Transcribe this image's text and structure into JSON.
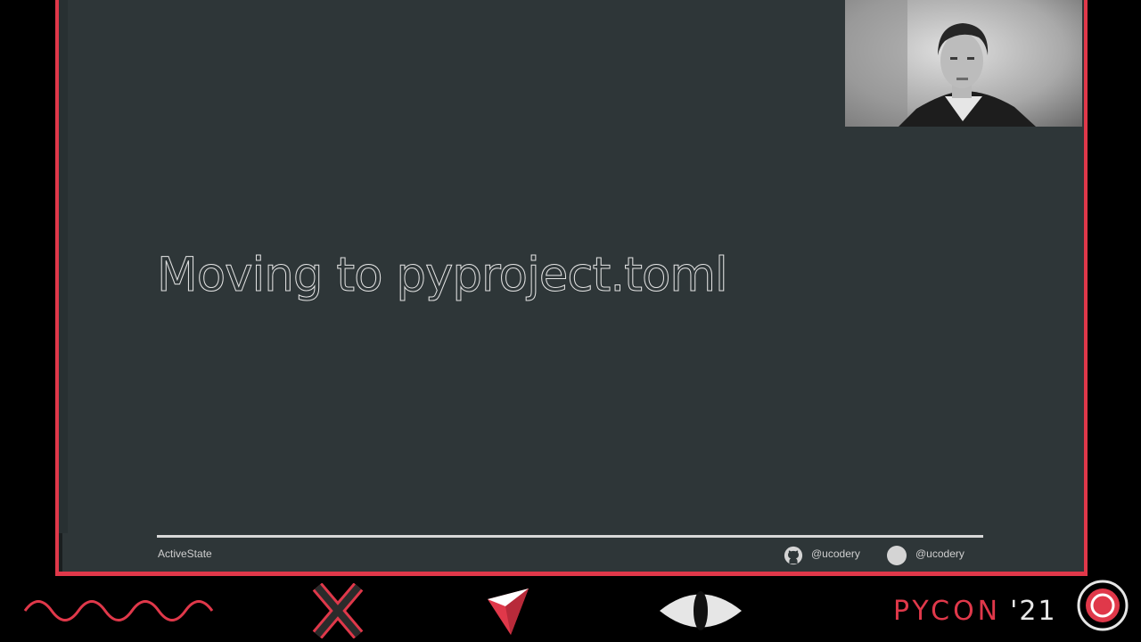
{
  "slide": {
    "title": "Moving to pyproject.toml",
    "footer": {
      "brand": "ActiveState",
      "github_handle": "@ucodery",
      "twitter_handle": "@ucodery"
    }
  },
  "conference": {
    "name": "PYCON",
    "year": "'21"
  },
  "colors": {
    "accent": "#e0384a",
    "slide_background": "#2e3638",
    "text": "#e4e4e4"
  },
  "icons": [
    "github-icon",
    "twitter-icon",
    "wave-icon",
    "x-icon",
    "triangle-icon",
    "eye-icon",
    "target-icon"
  ]
}
